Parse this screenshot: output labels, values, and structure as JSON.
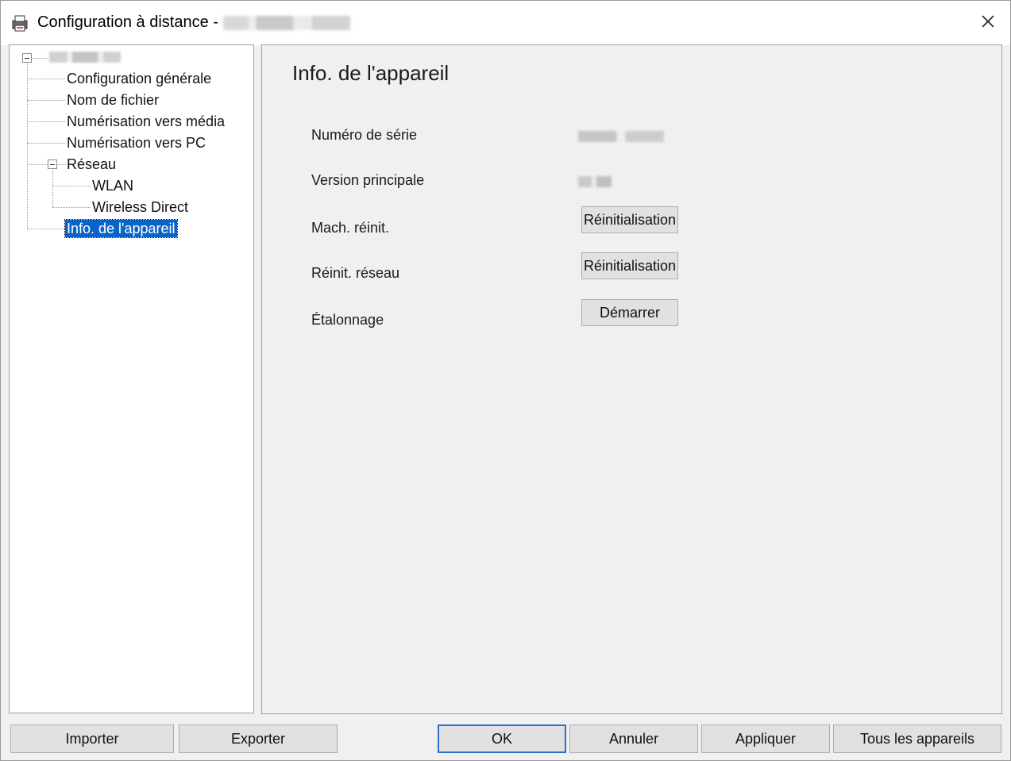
{
  "window": {
    "title": "Configuration à distance -"
  },
  "tree": {
    "items": [
      {
        "label": "Configuration générale"
      },
      {
        "label": "Nom de fichier"
      },
      {
        "label": "Numérisation vers média"
      },
      {
        "label": "Numérisation vers PC"
      },
      {
        "label": "Réseau"
      },
      {
        "label": "WLAN"
      },
      {
        "label": "Wireless Direct"
      },
      {
        "label": "Info. de l'appareil",
        "selected": true
      }
    ]
  },
  "panel": {
    "title": "Info. de l'appareil",
    "rows": [
      {
        "label": "Numéro de série"
      },
      {
        "label": "Version principale"
      },
      {
        "label": "Mach. réinit.",
        "button": "Réinitialisation"
      },
      {
        "label": "Réinit. réseau",
        "button": "Réinitialisation"
      },
      {
        "label": "Étalonnage",
        "button": "Démarrer"
      }
    ]
  },
  "footer": {
    "import": "Importer",
    "export": "Exporter",
    "ok": "OK",
    "cancel": "Annuler",
    "apply": "Appliquer",
    "all_devices": "Tous les appareils"
  },
  "icons": {
    "app": "printer-config-icon",
    "close": "close-icon"
  },
  "colors": {
    "selection": "#0a64c8",
    "default_button_border": "#2b6fcb"
  }
}
